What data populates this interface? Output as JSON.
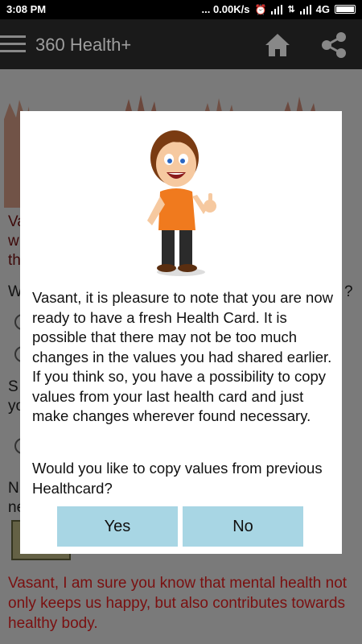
{
  "status_bar": {
    "time": "3:08 PM",
    "indicators": "... 0.00K/s",
    "network": "4G",
    "icons": [
      "alarm-off-icon",
      "signal-icon",
      "signal-icon",
      "battery-icon"
    ]
  },
  "app_bar": {
    "title": "360 Health+",
    "icons": [
      "menu-icon",
      "home-icon",
      "share-icon"
    ]
  },
  "background": {
    "text_fragments": [
      "Va",
      "w",
      "th",
      "W",
      "?",
      "S",
      "yo",
      "N",
      "ne"
    ],
    "footer": "Vasant, I am sure you know that mental health not only keeps us happy, but also contributes towards healthy body."
  },
  "dialog": {
    "message": "Vasant, it is pleasure to note that you are now ready to have a fresh Health Card. It is possible that there may not be too much changes in the values you had shared earlier. If you think so, you have a possibility to copy values from your last health card and just make changes wherever found necessary.",
    "question": "Would you like to copy values from previous Healthcard?",
    "yes_label": "Yes",
    "no_label": "No"
  },
  "colors": {
    "status_bar": "#000000",
    "app_bar": "#1a1a1a",
    "button": "#a8d6e4",
    "background_text": "#7a1010"
  }
}
